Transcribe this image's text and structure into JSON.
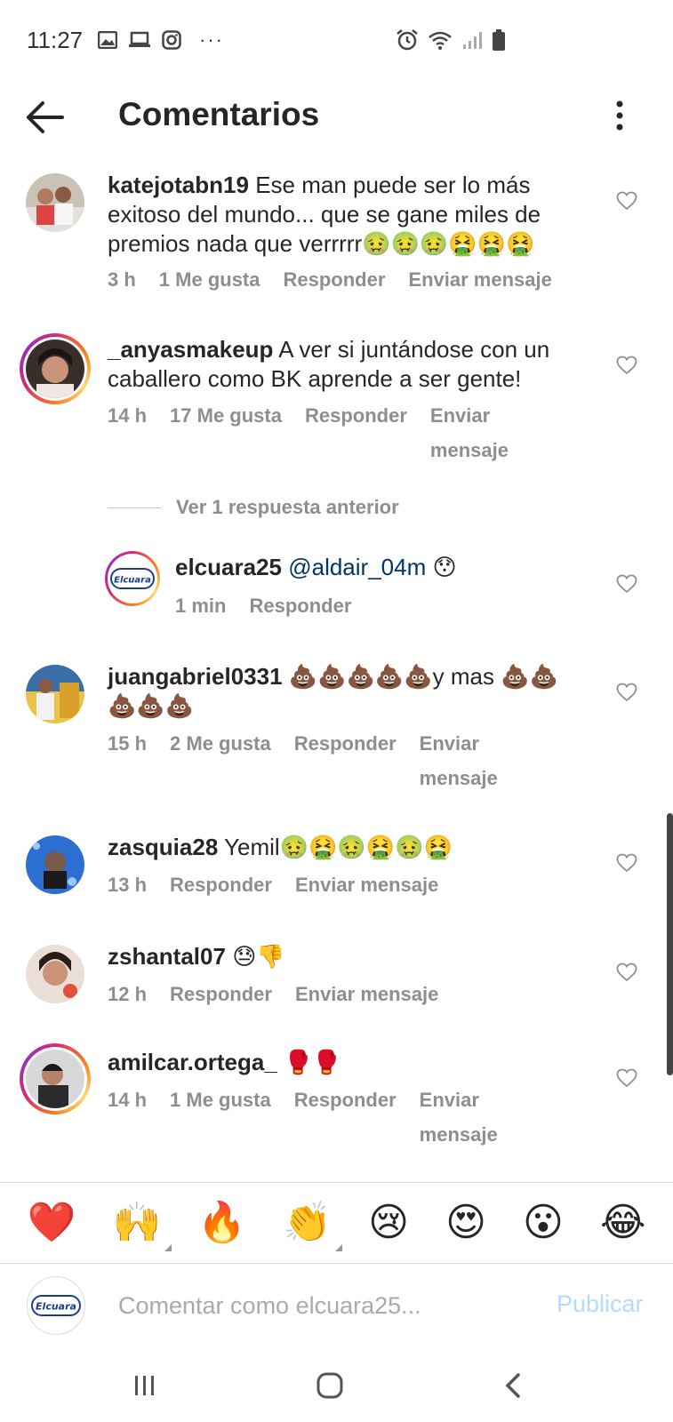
{
  "status_bar": {
    "time": "11:27",
    "dots": "···"
  },
  "header": {
    "title": "Comentarios"
  },
  "comments": [
    {
      "username": "katejotabn19",
      "text": "Ese man puede ser lo más exitoso del mundo... que se gane miles de premios nada que verrrrr🤢🤢🤢🤮🤮🤮",
      "time": "3 h",
      "likes": "1 Me gusta",
      "reply": "Responder",
      "message": "Enviar mensaje"
    },
    {
      "username": "_anyasmakeup",
      "text": "A ver si juntándose con un caballero como BK aprende a ser gente!",
      "time": "14 h",
      "likes": "17 Me gusta",
      "reply": "Responder",
      "message": "Enviar mensaje"
    },
    {
      "username": "elcuara25",
      "mention": "@aldair_04m",
      "text": "😯",
      "time": "1 min",
      "reply": "Responder"
    },
    {
      "username": "juangabriel0331",
      "text": "💩💩💩💩💩y mas 💩💩💩💩💩",
      "time": "15 h",
      "likes": "2 Me gusta",
      "reply": "Responder",
      "message": "Enviar mensaje"
    },
    {
      "username": "zasquia28",
      "text": "Yemil🤢🤮🤢🤮🤢🤮",
      "time": "13 h",
      "reply": "Responder",
      "message": "Enviar mensaje"
    },
    {
      "username": "zshantal07",
      "text": "😓👎",
      "time": "12 h",
      "reply": "Responder",
      "message": "Enviar mensaje"
    },
    {
      "username": "amilcar.ortega_",
      "text": "🥊🥊",
      "time": "14 h",
      "likes": "1 Me gusta",
      "reply": "Responder",
      "message": "Enviar mensaje"
    }
  ],
  "view_replies": "Ver 1 respuesta anterior",
  "emoji_bar": [
    "❤️",
    "🙌",
    "🔥",
    "👏",
    "😢",
    "😍",
    "😮",
    "😂"
  ],
  "composer": {
    "placeholder": "Comentar como elcuara25...",
    "publish": "Publicar",
    "avatar_logo": "Elcuara"
  },
  "colors": {
    "text": "#262626",
    "meta": "#8e8e8e",
    "mention": "#003569",
    "publish_disabled": "#b3dbff",
    "divider": "#dbdbdb"
  }
}
